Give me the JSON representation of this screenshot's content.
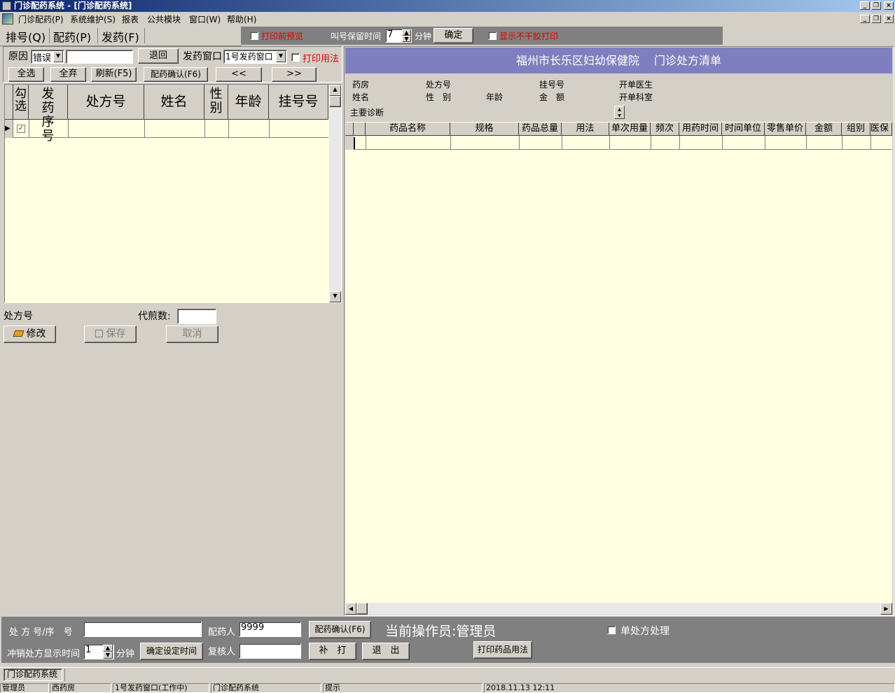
{
  "window": {
    "title": "门诊配药系统 - [门诊配药系统]"
  },
  "menu": [
    "门诊配药(P)",
    "系统维护(S)",
    "报表",
    "公共模块",
    "窗口(W)",
    "帮助(H)"
  ],
  "tabs": [
    "排号(Q)",
    "配药(P)",
    "发药(F)"
  ],
  "toolbar": {
    "print_preview": "打印前预览",
    "keep_time_label": "叫号保留时间",
    "keep_time_value": "7",
    "minute": "分钟",
    "confirm": "确定",
    "no_glue_print": "显示不干胶打印"
  },
  "left": {
    "reason_label": "原因",
    "reason_value": "错误",
    "return_btn": "退回",
    "window_label": "发药窗口",
    "window_value": "1号发药窗口",
    "print_usage": "打印用法",
    "select_all": "全选",
    "discard_all": "全弃",
    "refresh": "刷新(F5)",
    "dispense_confirm": "配药确认(F6)",
    "prev": "<<",
    "next": ">>",
    "columns": [
      "勾选",
      "发药序号",
      "处方号",
      "姓名",
      "性别",
      "年龄",
      "挂号号"
    ],
    "rx_label": "处方号",
    "decoct_label": "代煎数:",
    "modify": "修改",
    "save": "保存",
    "cancel": "取消"
  },
  "right": {
    "header": "福州市长乐区妇幼保健院　 门诊处方清单",
    "info": {
      "pharmacy": "药房",
      "rx_no": "处方号",
      "reg_no": "挂号号",
      "doctor": "开单医生",
      "name": "姓名",
      "gender": "性　别",
      "age": "年龄",
      "amount": "金　额",
      "dept": "开单科室",
      "diagnosis": "主要诊断"
    },
    "columns": [
      "药品名称",
      "规格",
      "药品总量",
      "用法",
      "单次用量",
      "频次",
      "用药时间",
      "时间单位",
      "零售单价",
      "金额",
      "组别",
      "医保"
    ]
  },
  "bottom": {
    "rx_seq_label": "处 方 号/序　号",
    "dispenser_label": "配药人",
    "dispenser_value": "9999",
    "dispense_confirm": "配药确认(F6)",
    "operator": "当前操作员:管理员",
    "single_rx": "单处方处理",
    "reversal_label": "冲销处方显示时间",
    "reversal_value": "1",
    "minute": "分钟",
    "set_time": "确定设定时间",
    "reviewer_label": "复核人",
    "reprint": "补　打",
    "exit": "退　出",
    "print_usage": "打印药品用法"
  },
  "taskbar": {
    "item": "门诊配药系统"
  },
  "status": [
    "管理员",
    "西药房",
    "1号发药窗口(工作中)",
    "门诊配药系统",
    "提示",
    "2018.11.13 12:11"
  ]
}
